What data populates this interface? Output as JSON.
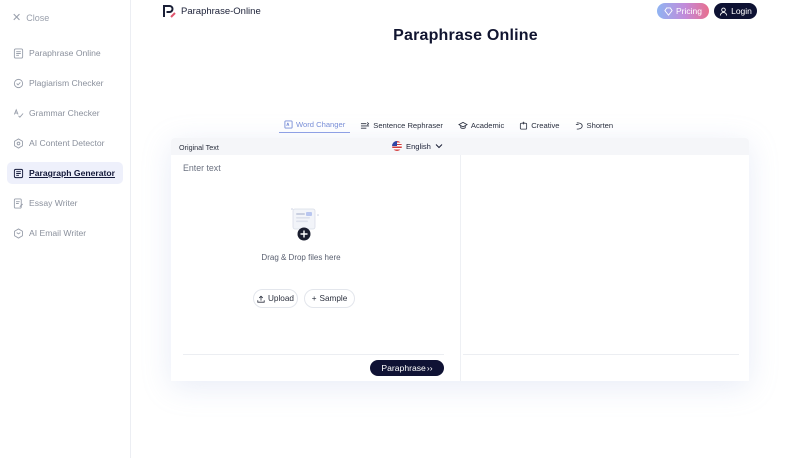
{
  "sidebar": {
    "close_label": "Close",
    "items": [
      {
        "label": "Paraphrase Online",
        "icon": "document-lines-icon",
        "active": false
      },
      {
        "label": "Plagiarism Checker",
        "icon": "magnifier-check-icon",
        "active": false
      },
      {
        "label": "Grammar Checker",
        "icon": "spell-check-icon",
        "active": false
      },
      {
        "label": "AI Content Detector",
        "icon": "ai-detect-icon",
        "active": false
      },
      {
        "label": "Paragraph Generator",
        "icon": "paragraph-icon",
        "active": true
      },
      {
        "label": "Essay Writer",
        "icon": "pen-document-icon",
        "active": false
      },
      {
        "label": "AI Email Writer",
        "icon": "ai-mail-icon",
        "active": false
      }
    ]
  },
  "header": {
    "logo_text": "Paraphrase-Online",
    "pricing_label": "Pricing",
    "login_label": "Login"
  },
  "page_title": "Paraphrase Online",
  "tabs": [
    {
      "label": "Word Changer",
      "icon": "word-changer-icon",
      "active": true
    },
    {
      "label": "Sentence Rephraser",
      "icon": "rephraser-icon",
      "active": false
    },
    {
      "label": "Academic",
      "icon": "academic-cap-icon",
      "active": false
    },
    {
      "label": "Creative",
      "icon": "creative-icon",
      "active": false
    },
    {
      "label": "Shorten",
      "icon": "shorten-icon",
      "active": false
    }
  ],
  "editor": {
    "original_label": "Original Text",
    "language": "English",
    "placeholder": "Enter text",
    "drop_text": "Drag & Drop files here",
    "upload_label": "Upload",
    "sample_label": "Sample",
    "paraphrase_label": "Paraphrase"
  },
  "colors": {
    "brand_dark": "#0f1234",
    "tab_active": "#7a8fd8",
    "pricing_gradient_start": "#8fb4f2",
    "pricing_gradient_end": "#e86f8e"
  }
}
